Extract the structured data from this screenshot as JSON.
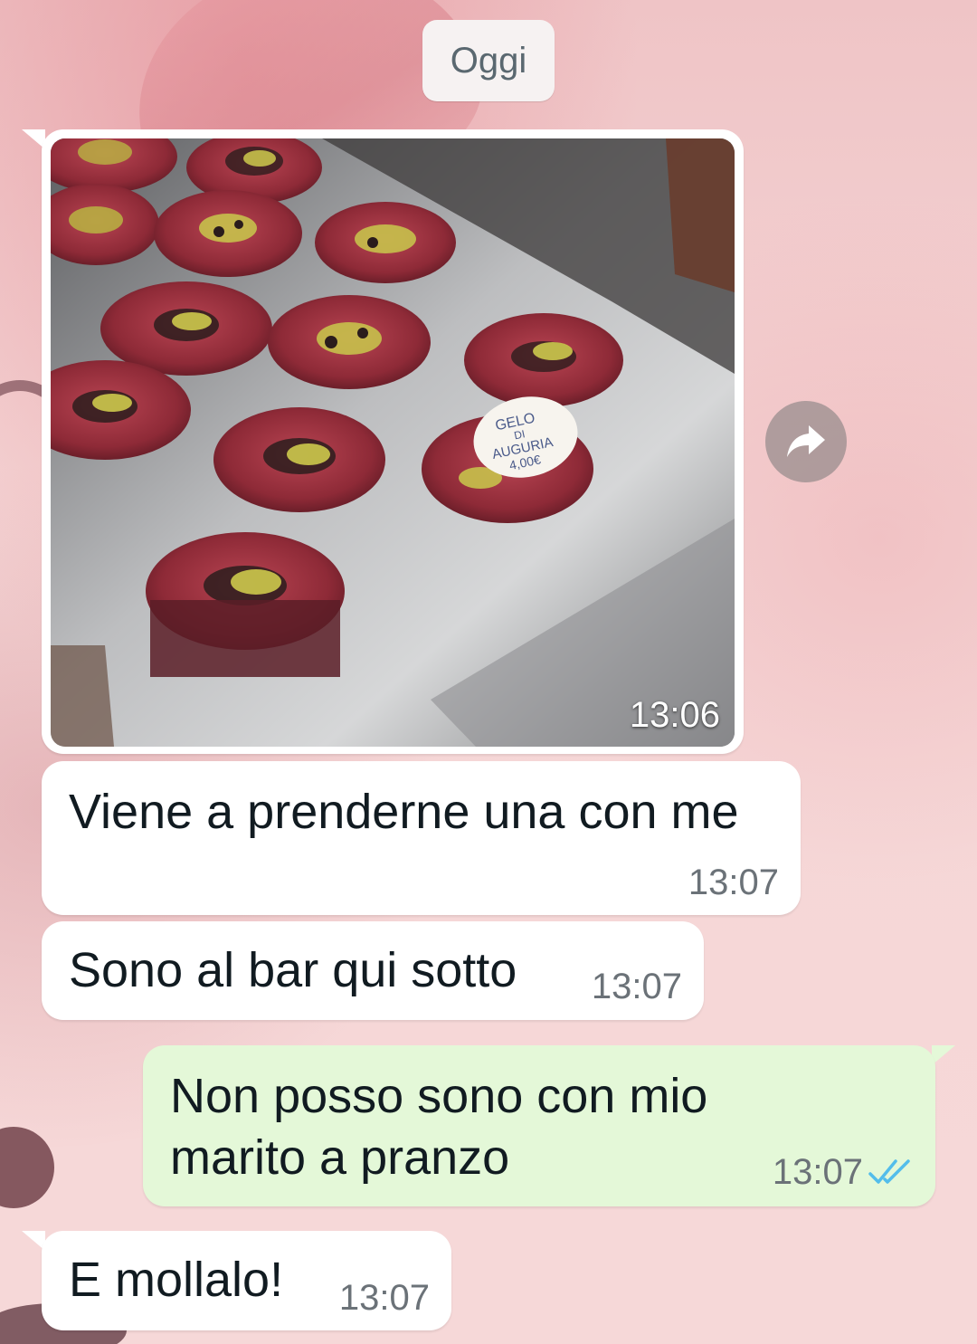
{
  "date_separator": "Oggi",
  "messages": [
    {
      "type": "image",
      "direction": "incoming",
      "time": "13:06",
      "image_label": "GELO DI AUGURIA 4,00€"
    },
    {
      "type": "text",
      "direction": "incoming",
      "text": "Viene a prenderne una con me",
      "time": "13:07"
    },
    {
      "type": "text",
      "direction": "incoming",
      "text": "Sono al bar qui sotto",
      "time": "13:07"
    },
    {
      "type": "text",
      "direction": "outgoing",
      "lines": [
        "Non posso sono con mio",
        "marito a pranzo"
      ],
      "time": "13:07",
      "status": "read"
    },
    {
      "type": "text",
      "direction": "incoming",
      "text": "E mollalo!",
      "time": "13:07"
    }
  ],
  "icons": {
    "forward": "forward-arrow-icon",
    "read_receipt": "double-check-icon"
  },
  "colors": {
    "incoming_bubble": "#ffffff",
    "outgoing_bubble": "#e4f8d8",
    "read_ticks": "#53bdeb",
    "wallpaper": "#f3d3d3"
  }
}
